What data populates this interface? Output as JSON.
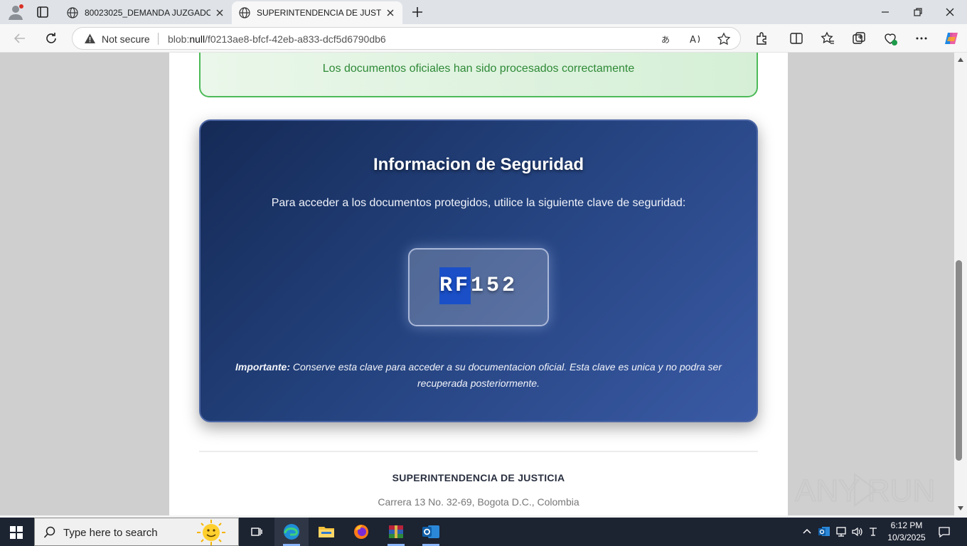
{
  "browser": {
    "tabs": [
      {
        "title": "80023025_DEMANDA JUZGADO C",
        "active": false
      },
      {
        "title": "SUPERINTENDENCIA DE JUSTICIA",
        "active": true
      }
    ],
    "address": {
      "security_label": "Not secure",
      "url_prefix": "blob:",
      "url_host": "null",
      "url_path": "/f0213ae8-bfcf-42eb-a833-dcf5d6790db6"
    }
  },
  "page": {
    "success_message": "Los documentos oficiales han sido procesados correctamente",
    "security_box": {
      "title": "Informacion de Seguridad",
      "instruction": "Para acceder a los documentos protegidos, utilice la siguiente clave de seguridad:",
      "key_selected": "RF",
      "key_rest": "152",
      "note_label": "Importante:",
      "note_text": " Conserve esta clave para acceder a su documentacion oficial. Esta clave es unica y no podra ser recuperada posteriormente."
    },
    "footer": {
      "name": "SUPERINTENDENCIA DE JUSTICIA",
      "address": "Carrera 13 No. 32-69, Bogota D.C., Colombia"
    }
  },
  "watermark": "ANY RUN",
  "taskbar": {
    "search_placeholder": "Type here to search",
    "time": "6:12 PM",
    "date": "10/3/2025"
  },
  "colors": {
    "accent_success": "#4cba58",
    "security_dark": "#152a56",
    "security_light": "#3a5aa5",
    "selection": "#1a4fc8"
  }
}
